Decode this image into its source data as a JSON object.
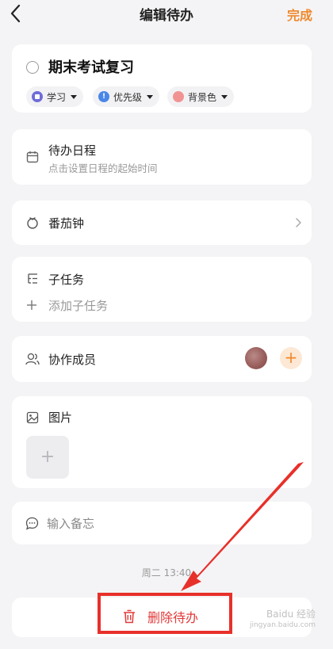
{
  "header": {
    "title": "编辑待办",
    "done_label": "完成"
  },
  "todo": {
    "title": "期末考试复习",
    "tags": [
      {
        "label": "学习",
        "color": "#6f6cd8"
      },
      {
        "label": "优先级",
        "color": "#4a86e8"
      },
      {
        "label": "背景色",
        "color": "#f29393"
      }
    ]
  },
  "schedule": {
    "label": "待办日程",
    "hint": "点击设置日程的起始时间"
  },
  "pomodoro": {
    "label": "番茄钟"
  },
  "subtask": {
    "label": "子任务",
    "add_label": "添加子任务"
  },
  "members": {
    "label": "协作成员"
  },
  "images": {
    "label": "图片"
  },
  "note": {
    "placeholder": "输入备忘"
  },
  "timestamp": "周二 13:40",
  "delete": {
    "label": "删除待办"
  },
  "watermark": {
    "brand": "Baidu 经验",
    "site": "jingyan.baidu.com"
  },
  "colors": {
    "accent": "#f0892c",
    "danger": "#e23a3a",
    "annotation": "#e8302a"
  }
}
